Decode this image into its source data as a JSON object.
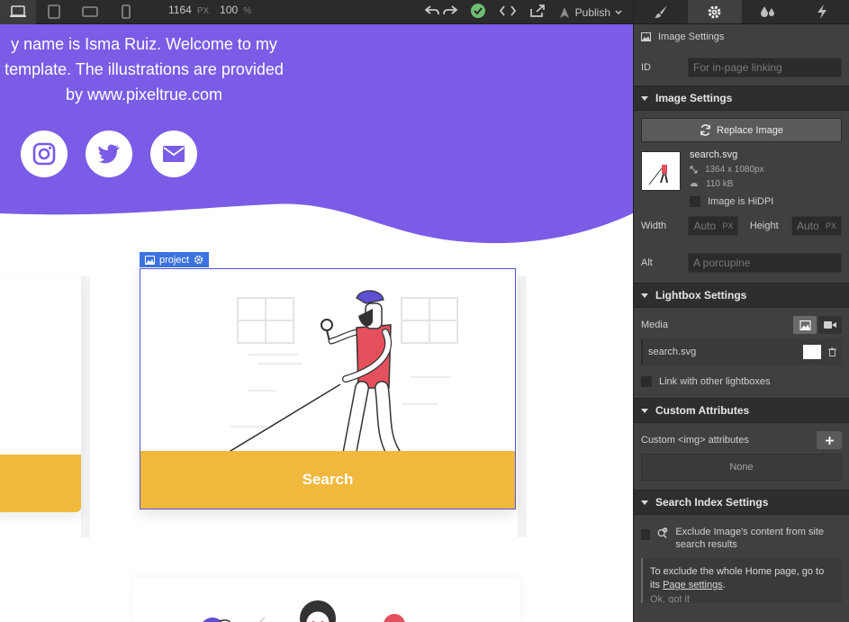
{
  "toolbar": {
    "viewport_width": "1164",
    "viewport_unit": "PX",
    "zoom": "100",
    "zoom_unit": "%",
    "publish_label": "Publish"
  },
  "canvas": {
    "hero_text_lines": [
      "y name is Isma Ruiz. Welcome to my",
      "template. The illustrations are provided",
      "by www.pixeltrue.com"
    ],
    "selected_element_label": "project",
    "card_button_label": "Search"
  },
  "panel": {
    "header_title": "Image Settings",
    "id_label": "ID",
    "id_placeholder": "For in-page linking",
    "image_settings": {
      "title": "Image Settings",
      "replace_label": "Replace Image",
      "file_name": "search.svg",
      "dimensions": "1364 x 1080px",
      "size": "110 kB",
      "hidpi_label": "Image is HiDPI",
      "width_label": "Width",
      "width_value": "Auto",
      "width_unit": "PX",
      "height_label": "Height",
      "height_value": "Auto",
      "height_unit": "PX",
      "alt_label": "Alt",
      "alt_placeholder": "A porcupine"
    },
    "lightbox": {
      "title": "Lightbox Settings",
      "media_label": "Media",
      "media_file": "search.svg",
      "link_label": "Link with other lightboxes"
    },
    "custom_attributes": {
      "title": "Custom Attributes",
      "label": "Custom <img> attributes",
      "none_label": "None"
    },
    "search_index": {
      "title": "Search Index Settings",
      "exclude_label": "Exclude Image's content from site search results",
      "note_prefix": "To exclude the whole Home page, go to its ",
      "note_link": "Page settings",
      "note_suffix": ".",
      "ok_label": "Ok, got it"
    }
  },
  "colors": {
    "hero": "#7b5ce6",
    "accent_yellow": "#f0b83c",
    "selection_blue": "#3c73e0",
    "panel_bg": "#404040"
  }
}
